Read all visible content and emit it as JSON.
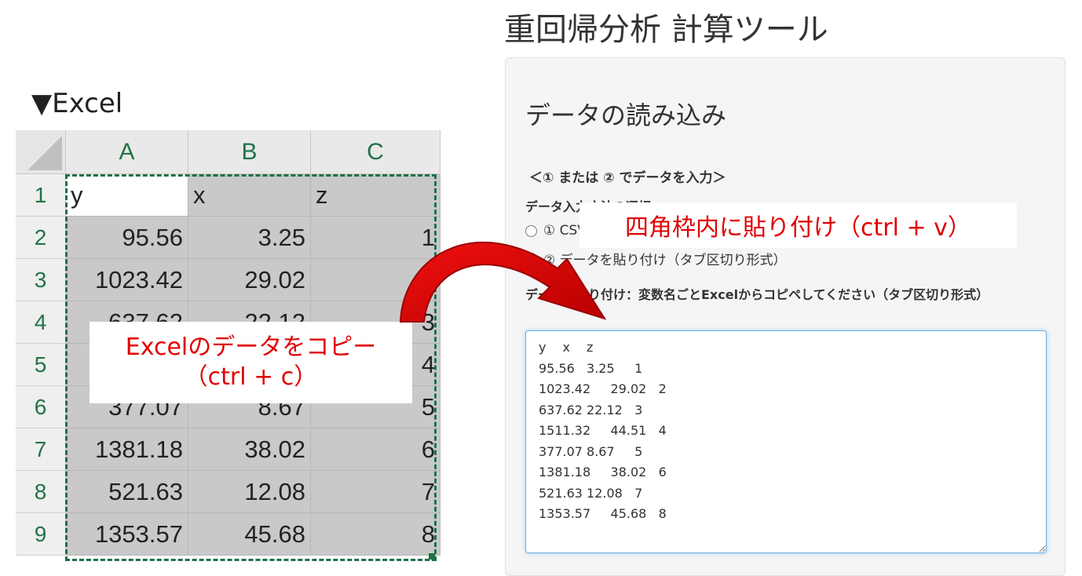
{
  "excel": {
    "heading": "▼Excel",
    "columns": [
      "A",
      "B",
      "C"
    ],
    "rows": [
      {
        "num": "1",
        "a": "y",
        "b": "x",
        "c": "z"
      },
      {
        "num": "2",
        "a": "95.56",
        "b": "3.25",
        "c": "1"
      },
      {
        "num": "3",
        "a": "1023.42",
        "b": "29.02",
        "c": ""
      },
      {
        "num": "4",
        "a": "637.62",
        "b": "22.12",
        "c": "3"
      },
      {
        "num": "5",
        "a": "",
        "b": "",
        "c": "4"
      },
      {
        "num": "6",
        "a": "377.07",
        "b": "8.67",
        "c": "5"
      },
      {
        "num": "7",
        "a": "1381.18",
        "b": "38.02",
        "c": "6"
      },
      {
        "num": "8",
        "a": "521.63",
        "b": "12.08",
        "c": "7"
      },
      {
        "num": "9",
        "a": "1353.57",
        "b": "45.68",
        "c": "8"
      }
    ],
    "colors": {
      "header_text": "#217346",
      "marquee": "#1e7145",
      "selection": "#c9c9c9"
    }
  },
  "tool": {
    "title": "重回帰分析 計算ツール",
    "panel_heading": "データの読み込み",
    "section_note": "＜① または ② でデータを入力＞",
    "method_label": "データ入力方法の選択",
    "radio_options": [
      {
        "label": "① CSV",
        "checked": false
      },
      {
        "label": "② データを貼り付け（タブ区切り形式）",
        "checked": true
      }
    ],
    "paste_label": "データを貼り付け：変数名ごとExcelからコピペしてください（タブ区切り形式）",
    "textarea_value": "y\tx\tz\n95.56\t3.25\t1\n1023.42\t29.02\t2\n637.62\t22.12\t3\n1511.32\t44.51\t4\n377.07\t8.67\t5\n1381.18\t38.02\t6\n521.63\t12.08\t7\n1353.57\t45.68\t8\n"
  },
  "annotations": {
    "copy_line1": "Excelのデータをコピー",
    "copy_line2": "（ctrl + c）",
    "paste": "四角枠内に貼り付け（ctrl + v）",
    "color": "#e00000"
  }
}
